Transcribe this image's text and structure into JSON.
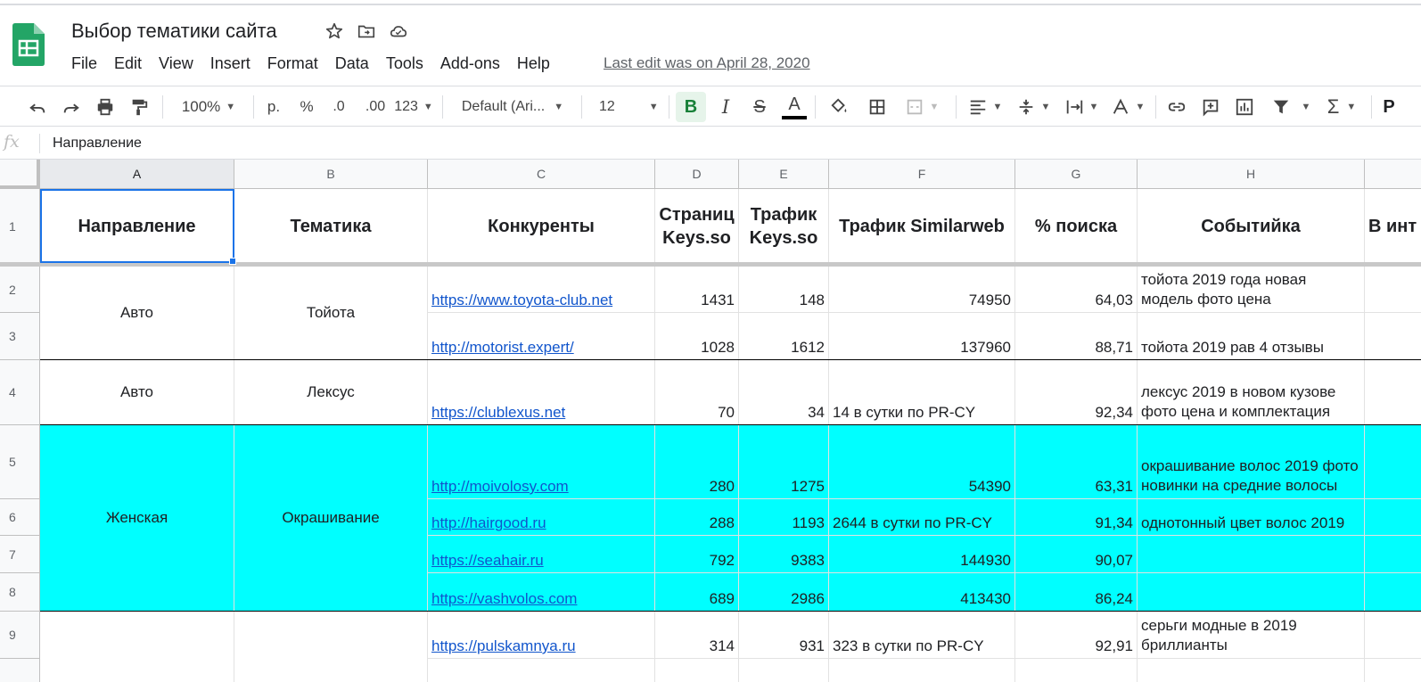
{
  "doc": {
    "title": "Выбор тематики сайта",
    "last_edit": "Last edit was on April 28, 2020"
  },
  "menu": [
    "File",
    "Edit",
    "View",
    "Insert",
    "Format",
    "Data",
    "Tools",
    "Add-ons",
    "Help"
  ],
  "toolbar": {
    "zoom": "100%",
    "currency": "р.",
    "percent": "%",
    "dec_less": ".0",
    "dec_more": ".00",
    "format_more": "123",
    "font": "Default (Ari...",
    "font_size": "12",
    "bold": "B",
    "italic": "I",
    "strike": "S",
    "text_color_letter": "A",
    "sum": "Σ",
    "cut_letter": "P"
  },
  "formula_bar": {
    "fx": "fx",
    "value": "Направление"
  },
  "columns": [
    "A",
    "B",
    "C",
    "D",
    "E",
    "F",
    "G",
    "H"
  ],
  "rows": [
    "1",
    "2",
    "3",
    "4",
    "5",
    "6",
    "7",
    "8",
    "9"
  ],
  "headers": {
    "a": "Направление",
    "b": "Тематика",
    "c": "Конкуренты",
    "d": "Страниц Keys.so",
    "e": "Трафик Keys.so",
    "f": "Трафик Similarweb",
    "g": "% поиска",
    "h": "Событийка",
    "i": "В инт"
  },
  "groups": [
    {
      "direction": "Авто",
      "topic": "Тойота"
    },
    {
      "direction": "Авто",
      "topic": "Лексус"
    },
    {
      "direction": "Женская",
      "topic": "Окрашивание"
    }
  ],
  "data_rows": [
    {
      "site": "https://www.toyota-club.net",
      "pages": "1431",
      "traffic_keys": "148",
      "traffic_sw": "74950",
      "search_pct": "64,03",
      "event": "тойота 2019 года новая модель фото цена"
    },
    {
      "site": "http://motorist.expert/",
      "pages": "1028",
      "traffic_keys": "1612",
      "traffic_sw": "137960",
      "search_pct": "88,71",
      "event": "тойота 2019 рав 4 отзывы"
    },
    {
      "site": "https://clublexus.net",
      "pages": "70",
      "traffic_keys": "34",
      "traffic_sw": "14 в сутки по PR-CY",
      "search_pct": "92,34",
      "event": "лексус 2019 в новом кузове фото цена и комплектация"
    },
    {
      "site": "http://moivolosy.com",
      "pages": "280",
      "traffic_keys": "1275",
      "traffic_sw": "54390",
      "search_pct": "63,31",
      "event": "окрашивание волос 2019 фото новинки на средние волосы"
    },
    {
      "site": "http://hairgood.ru",
      "pages": "288",
      "traffic_keys": "1193",
      "traffic_sw": "2644 в сутки по PR-CY",
      "search_pct": "91,34",
      "event": "однотонный цвет волос 2019"
    },
    {
      "site": "https://seahair.ru",
      "pages": "792",
      "traffic_keys": "9383",
      "traffic_sw": "144930",
      "search_pct": "90,07",
      "event": ""
    },
    {
      "site": "https://vashvolos.com",
      "pages": "689",
      "traffic_keys": "2986",
      "traffic_sw": "413430",
      "search_pct": "86,24",
      "event": ""
    },
    {
      "site": "https://pulskamnya.ru",
      "pages": "314",
      "traffic_keys": "931",
      "traffic_sw": "323 в сутки по PR-CY",
      "search_pct": "92,91",
      "event": "серьги модные в 2019 бриллианты"
    }
  ],
  "colors": {
    "highlight": "#00ffff",
    "selection": "#1a73e8",
    "link": "#1155cc",
    "bold_active": "#188038"
  }
}
